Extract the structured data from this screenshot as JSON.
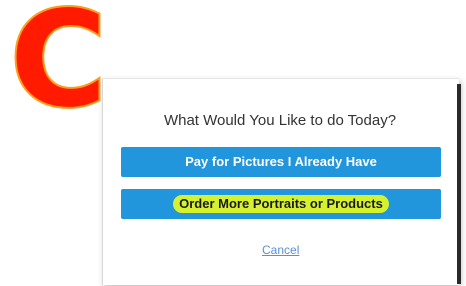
{
  "annotation": {
    "letter": "C",
    "letter_color": "#ff1a00",
    "outline_color": "#ff9c1a"
  },
  "dialog": {
    "title": "What Would You Like to do Today?",
    "pay_button_label": "Pay for Pictures I Already Have",
    "order_button_label": "Order More Portraits or Products",
    "cancel_label": "Cancel",
    "button_color": "#2196dc",
    "highlight_color": "#d6f22e"
  }
}
